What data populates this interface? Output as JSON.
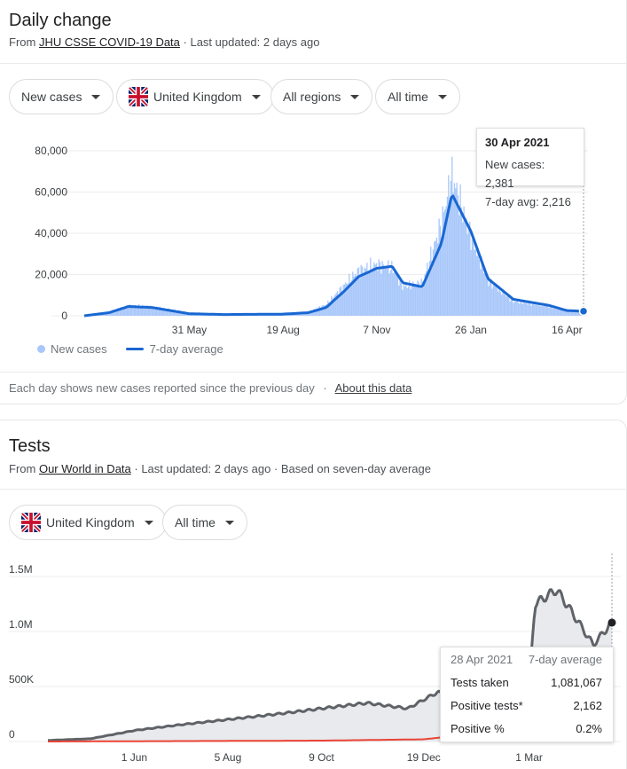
{
  "daily": {
    "title": "Daily change",
    "source_prefix": "From",
    "source_link": "JHU CSSE COVID-19 Data",
    "source_suffix": "· Last updated: 2 days ago",
    "chips": {
      "metric": "New cases",
      "country": "United Kingdom",
      "regions": "All regions",
      "range": "All time"
    },
    "legend": {
      "bars": "New cases",
      "line": "7-day average"
    },
    "footnote": "Each day shows new cases reported since the previous day",
    "footnote_sep": "·",
    "about_link": "About this data",
    "tooltip": {
      "date": "30 Apr 2021",
      "new_cases": "New cases: 2,381",
      "avg": "7-day avg: 2,216"
    }
  },
  "tests": {
    "title": "Tests",
    "source_prefix": "From",
    "source_link": "Our World in Data",
    "source_suffix": "· Last updated: 2 days ago · Based on seven-day average",
    "chips": {
      "country": "United Kingdom",
      "range": "All time"
    },
    "tooltip": {
      "date": "28 Apr 2021",
      "header_right": "7-day average",
      "rows": [
        {
          "label": "Tests taken",
          "value": "1,081,067"
        },
        {
          "label": "Positive tests*",
          "value": "2,162"
        },
        {
          "label": "Positive %",
          "value": "0.2%"
        }
      ]
    }
  },
  "colors": {
    "bar": "#a8c7fa",
    "avg_line": "#1967d2",
    "tests_line": "#5f6368",
    "tests_fill": "#e8eaed",
    "positive_line": "#ea4335"
  },
  "chart_data": [
    {
      "type": "bar",
      "ylim": [
        0,
        80000
      ],
      "y_ticks": [
        0,
        20000,
        40000,
        60000,
        80000
      ],
      "y_tick_labels": [
        "0",
        "20,000",
        "40,000",
        "60,000",
        "80,000"
      ],
      "x_tick_labels": [
        "31 May",
        "19 Aug",
        "7 Nov",
        "26 Jan",
        "16 Apr"
      ],
      "series": [
        {
          "name": "7-day average",
          "x": [
            "3 Mar",
            "24 Mar",
            "10 Apr",
            "30 Apr",
            "31 May",
            "30 Jun",
            "19 Aug",
            "10 Sep",
            "25 Sep",
            "10 Oct",
            "22 Oct",
            "7 Nov",
            "20 Nov",
            "29 Nov",
            "15 Dec",
            "1 Jan",
            "10 Jan",
            "26 Jan",
            "10 Feb",
            "1 Mar",
            "1 Apr",
            "16 Apr",
            "30 Apr"
          ],
          "values": [
            0,
            1500,
            4500,
            4000,
            1000,
            600,
            800,
            1500,
            4000,
            12000,
            19000,
            23000,
            24000,
            16000,
            14000,
            35000,
            59000,
            41000,
            18000,
            8000,
            5000,
            2500,
            2216
          ]
        },
        {
          "name": "New cases",
          "x": [
            "3 Mar",
            "24 Mar",
            "10 Apr",
            "30 Apr",
            "31 May",
            "30 Jun",
            "19 Aug",
            "10 Sep",
            "25 Sep",
            "10 Oct",
            "22 Oct",
            "7 Nov",
            "20 Nov",
            "29 Nov",
            "15 Dec",
            "1 Jan",
            "10 Jan",
            "26 Jan",
            "10 Feb",
            "1 Mar",
            "1 Apr",
            "16 Apr",
            "30 Apr"
          ],
          "values": [
            0,
            1800,
            5000,
            4500,
            1200,
            700,
            900,
            2000,
            5500,
            15000,
            22000,
            25000,
            23000,
            14000,
            16000,
            45000,
            68000,
            38000,
            17000,
            7000,
            4500,
            2200,
            2381
          ]
        }
      ]
    },
    {
      "type": "area",
      "ylim": [
        0,
        1500000
      ],
      "y_ticks": [
        0,
        500000,
        1000000,
        1500000
      ],
      "y_tick_labels": [
        "0",
        "500K",
        "1.0M",
        "1.5M"
      ],
      "x_tick_labels": [
        "1 Jun",
        "5 Aug",
        "9 Oct",
        "19 Dec",
        "1 Mar"
      ],
      "series": [
        {
          "name": "Tests taken",
          "x": [
            "2 Apr",
            "1 May",
            "1 Jun",
            "1 Jul",
            "5 Aug",
            "9 Sep",
            "9 Oct",
            "10 Nov",
            "8 Dec",
            "19 Dec",
            "29 Dec",
            "10 Jan",
            "1 Feb",
            "1 Mar",
            "5 Mar",
            "20 Mar",
            "28 Mar",
            "15 Apr",
            "28 Apr"
          ],
          "values": [
            10000,
            25000,
            100000,
            150000,
            200000,
            250000,
            300000,
            350000,
            300000,
            380000,
            450000,
            370000,
            420000,
            480000,
            1250000,
            1380000,
            1230000,
            880000,
            1081067
          ]
        },
        {
          "name": "Positive tests*",
          "x": [
            "2 Apr",
            "9 Oct",
            "19 Dec",
            "10 Jan",
            "1 Mar",
            "28 Apr"
          ],
          "values": [
            0,
            8000,
            20000,
            50000,
            6000,
            2162
          ]
        }
      ]
    }
  ]
}
